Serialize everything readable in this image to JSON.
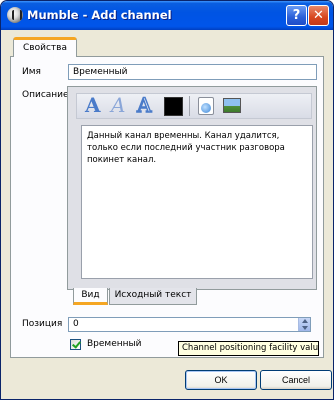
{
  "window": {
    "title": "Mumble - Add channel",
    "help_button": "?",
    "close_button": "✕"
  },
  "tabs": [
    {
      "label": "Свойства"
    }
  ],
  "form": {
    "name_label": "Имя",
    "name_value": "Временный",
    "description_label": "Описание",
    "description_text": "Данный канал временны. Канал удалится, только если  последний участник разговора покинет канал.",
    "toolbar": {
      "bold_icon": "A",
      "italic_icon": "A",
      "outline_icon": "A",
      "text_color": "#000000"
    },
    "editor_tabs": [
      {
        "label": "Вид"
      },
      {
        "label": "Исходный текст"
      }
    ],
    "position_label": "Позиция",
    "position_value": "0",
    "temporary_label": "Временный"
  },
  "tooltip": "Channel positioning facility value",
  "buttons": {
    "ok": "OK",
    "cancel": "Cancel"
  }
}
